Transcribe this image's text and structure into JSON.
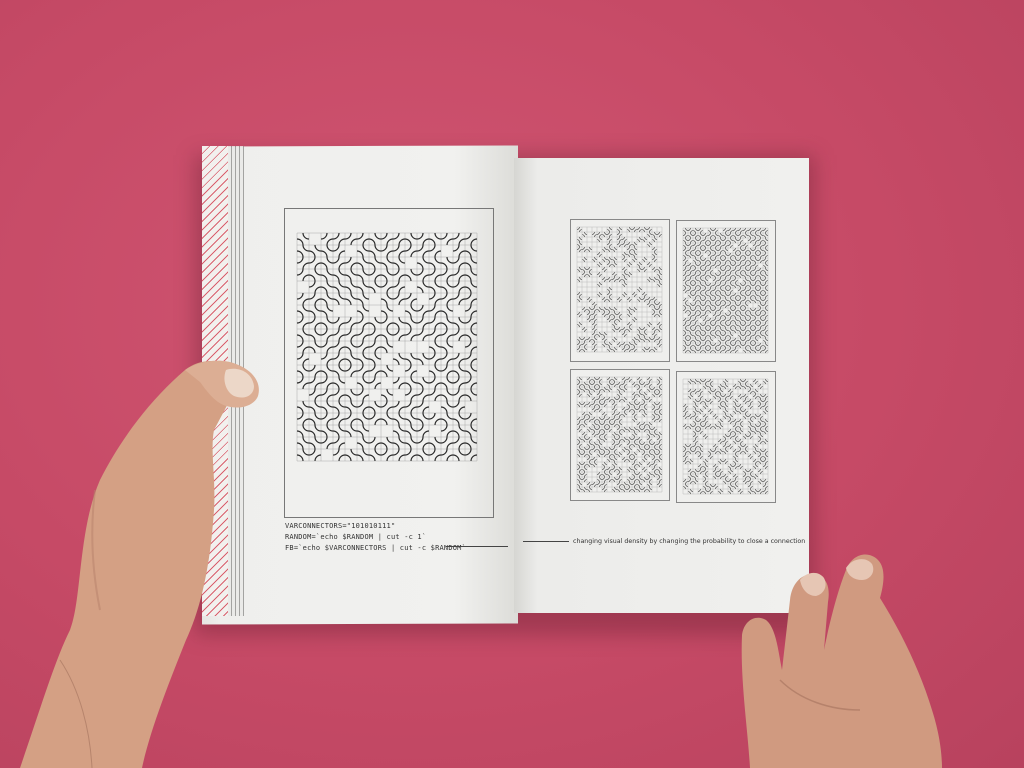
{
  "scene": {
    "description_free": true
  },
  "colors": {
    "background": "#c94c68",
    "paper": "#eeeeec",
    "ink": "#333333",
    "hatch": "#d9606e",
    "skin": "#d49a7c"
  },
  "left_page": {
    "code_lines": [
      "VARCONNECTORS=\"101010111\"",
      "RANDOM=`echo $RANDOM | cut -c 1`",
      "FB=`echo $VARCONNECTORS | cut -c $RANDOM`"
    ]
  },
  "right_page": {
    "caption": "changing visual density by changing the probability to close a connection"
  },
  "icons": {
    "main_pattern": "truchet-grid-illustration",
    "thumbnails": "truchet-grid-thumbnail"
  }
}
